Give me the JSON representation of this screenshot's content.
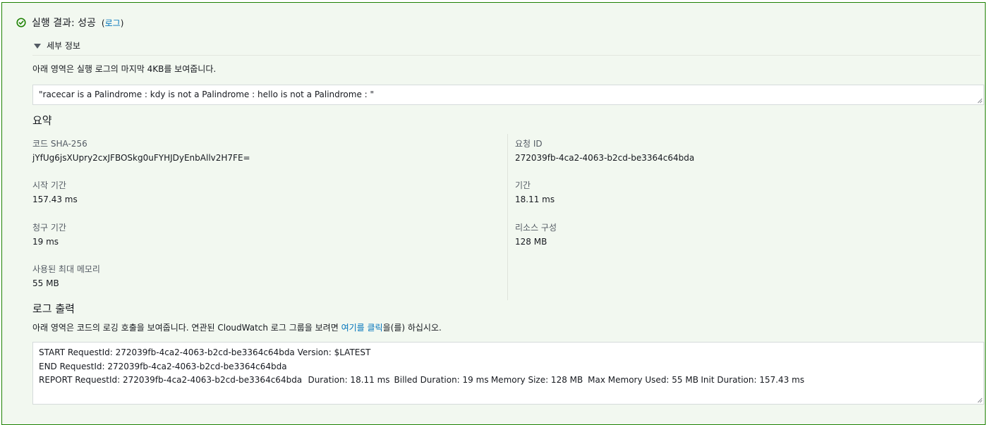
{
  "result": {
    "title": "실행 결과: 성공",
    "paren_open": "(",
    "log_link": "로그",
    "paren_close": ")"
  },
  "details": {
    "toggle_label": "세부 정보",
    "description": "아래 영역은 실행 로그의 마지막 4KB를 보여줍니다.",
    "output": "\"racecar is a Palindrome : kdy is not a Palindrome : hello is not a Palindrome : \""
  },
  "summary": {
    "title": "요약",
    "code_sha_label": "코드 SHA-256",
    "code_sha_value": "jYfUg6jsXUpry2cxJFBOSkg0uFYHJDyEnbAllv2H7FE=",
    "request_id_label": "요청 ID",
    "request_id_value": "272039fb-4ca2-4063-b2cd-be3364c64bda",
    "init_duration_label": "시작 기간",
    "init_duration_value": "157.43 ms",
    "duration_label": "기간",
    "duration_value": "18.11 ms",
    "billed_duration_label": "청구 기간",
    "billed_duration_value": "19 ms",
    "resources_label": "리소스 구성",
    "resources_value": "128 MB",
    "max_memory_label": "사용된 최대 메모리",
    "max_memory_value": "55 MB"
  },
  "log_output": {
    "title": "로그 출력",
    "description_prefix": "아래 영역은 코드의 로깅 호출을 보여줍니다. 연관된 CloudWatch 로그 그룹을 보려면 ",
    "description_link": "여기를 클릭",
    "description_suffix": "을(를) 하십시오.",
    "lines": [
      "START RequestId: 272039fb-4ca2-4063-b2cd-be3364c64bda Version: $LATEST",
      "END RequestId: 272039fb-4ca2-4063-b2cd-be3364c64bda",
      "REPORT RequestId: 272039fb-4ca2-4063-b2cd-be3364c64bda\tDuration: 18.11 ms\tBilled Duration: 19 ms\tMemory Size: 128 MB\tMax Memory Used: 55 MB\tInit Duration: 157.43 ms"
    ]
  },
  "colors": {
    "success": "#1d8102",
    "link": "#0073bb",
    "panel_bg": "#f2f8f0"
  },
  "icons": {
    "status": "check-circle-icon",
    "toggle": "caret-down-icon",
    "resize": "resize-handle-icon"
  }
}
